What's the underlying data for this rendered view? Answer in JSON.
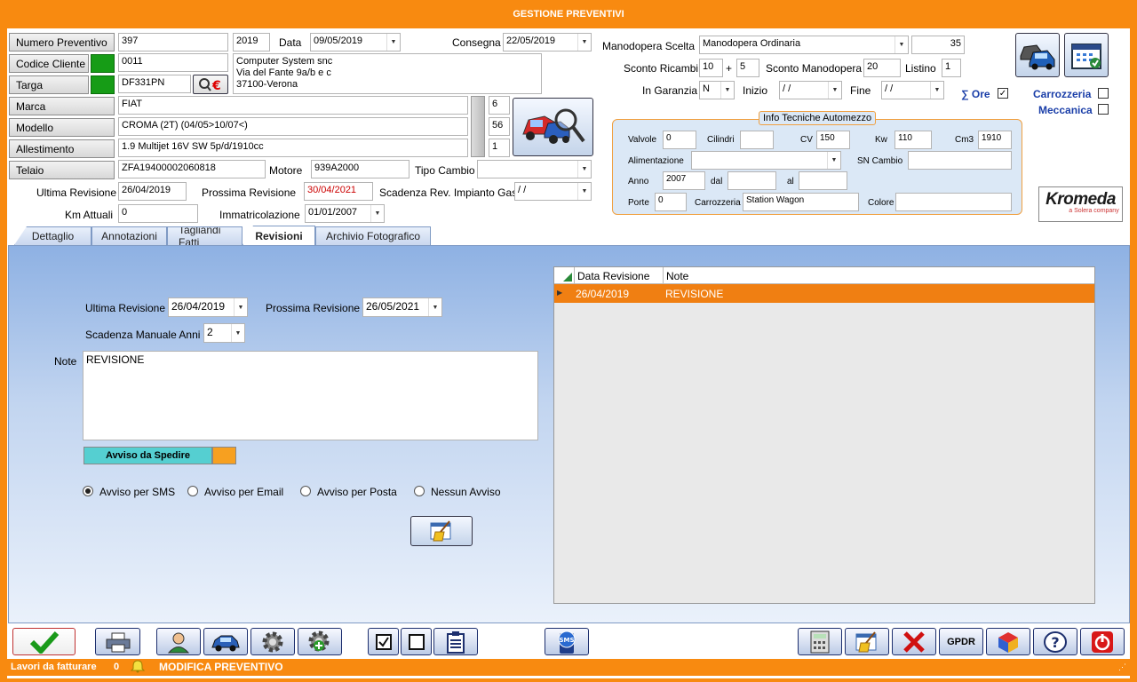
{
  "window": {
    "title": "GESTIONE PREVENTIVI"
  },
  "header": {
    "numero_preventivo": {
      "label": "Numero Preventivo",
      "value": "397",
      "year": "2019"
    },
    "data": {
      "label": "Data",
      "value": "09/05/2019"
    },
    "consegna": {
      "label": "Consegna",
      "value": "22/05/2019"
    },
    "codice_cliente": {
      "label": "Codice Cliente",
      "value": "0011"
    },
    "cliente": {
      "line1": "Computer System snc",
      "line2": "Via del Fante 9a/b e c",
      "line3": "37100-Verona"
    },
    "targa": {
      "label": "Targa",
      "value": "DF331PN"
    },
    "marca": {
      "label": "Marca",
      "value": "FIAT",
      "code": "6"
    },
    "modello": {
      "label": "Modello",
      "value": "CROMA (2T) (04/05>10/07<)",
      "code": "56"
    },
    "allestimento": {
      "label": "Allestimento",
      "value": "1.9 Multijet 16V SW 5p/d/1910cc",
      "code": "1"
    },
    "telaio": {
      "label": "Telaio",
      "value": "ZFA19400002060818"
    },
    "motore": {
      "label": "Motore",
      "value": "939A2000"
    },
    "tipo_cambio": {
      "label": "Tipo Cambio",
      "value": ""
    },
    "ultima_revisione": {
      "label": "Ultima Revisione",
      "value": "26/04/2019"
    },
    "prossima_revisione": {
      "label": "Prossima Revisione",
      "value": "30/04/2021"
    },
    "scadenza_gas": {
      "label": "Scadenza Rev. Impianto Gas",
      "value": " /  /"
    },
    "km_attuali": {
      "label": "Km Attuali",
      "value": "0"
    },
    "immatricolazione": {
      "label": "Immatricolazione",
      "value": "01/01/2007"
    }
  },
  "right": {
    "manodopera_label": "Manodopera Scelta",
    "manodopera_value": "Manodopera Ordinaria",
    "manodopera_amount": "35",
    "sconto_ricambi_label": "Sconto Ricambi",
    "sconto_ricambi_1": "10",
    "plus": "+",
    "sconto_ricambi_2": "5",
    "sconto_manodopera_label": "Sconto Manodopera",
    "sconto_manodopera_value": "20",
    "listino_label": "Listino",
    "listino_value": "1",
    "garanzia_label": "In Garanzia",
    "garanzia_value": "N",
    "inizio_label": "Inizio",
    "inizio_value": " /  /",
    "fine_label": "Fine",
    "fine_value": " /  /",
    "ore_label": "∑ Ore",
    "carrozzeria_label": "Carrozzeria",
    "meccanica_label": "Meccanica",
    "brand": "Kromeda",
    "brand_sub": "a Solera company"
  },
  "info": {
    "title": "Info Tecniche Automezzo",
    "valvole_label": "Valvole",
    "valvole": "0",
    "cilindri_label": "Cilindri",
    "cilindri": "",
    "cv_label": "CV",
    "cv": "150",
    "kw_label": "Kw",
    "kw": "110",
    "cm3_label": "Cm3",
    "cm3": "1910",
    "alimentazione_label": "Alimentazione",
    "alimentazione": "",
    "sn_cambio_label": "SN Cambio",
    "sn_cambio": "",
    "anno_label": "Anno",
    "anno": "2007",
    "dal_label": "dal",
    "dal": "",
    "al_label": "al",
    "al": "",
    "porte_label": "Porte",
    "porte": "0",
    "carrozzeria_label": "Carrozzeria",
    "carrozzeria": "Station Wagon",
    "colore_label": "Colore",
    "colore": ""
  },
  "tabs": [
    {
      "label": "Dettaglio"
    },
    {
      "label": "Annotazioni"
    },
    {
      "label": "Tagliandi Fatti"
    },
    {
      "label": "Revisioni"
    },
    {
      "label": "Archivio Fotografico"
    }
  ],
  "revisioni": {
    "ultima_label": "Ultima Revisione",
    "ultima": "26/04/2019",
    "prossima_label": "Prossima Revisione",
    "prossima": "26/05/2021",
    "scadenza_label": "Scadenza Manuale Anni",
    "scadenza": "2",
    "note_label": "Note",
    "note": "REVISIONE",
    "avviso_label": "Avviso da Spedire",
    "radios": [
      {
        "label": "Avviso per SMS",
        "checked": true
      },
      {
        "label": "Avviso per Email",
        "checked": false
      },
      {
        "label": "Avviso per Posta",
        "checked": false
      },
      {
        "label": "Nessun Avviso",
        "checked": false
      }
    ],
    "grid": {
      "columns": [
        "Data Revisione",
        "Note"
      ],
      "rows": [
        {
          "data": "26/04/2019",
          "note": "REVISIONE"
        }
      ]
    }
  },
  "toolbar": {
    "gpdr_label": "GPDR",
    "sms_label": "SMS"
  },
  "status": {
    "lavori_label": "Lavori da fatturare",
    "lavori_count": "0",
    "mode": "MODIFICA PREVENTIVO"
  },
  "colors": {
    "accent": "#f88a10",
    "grid_selected": "#f07f12",
    "date_red": "#cc0000",
    "green": "#169c16"
  }
}
